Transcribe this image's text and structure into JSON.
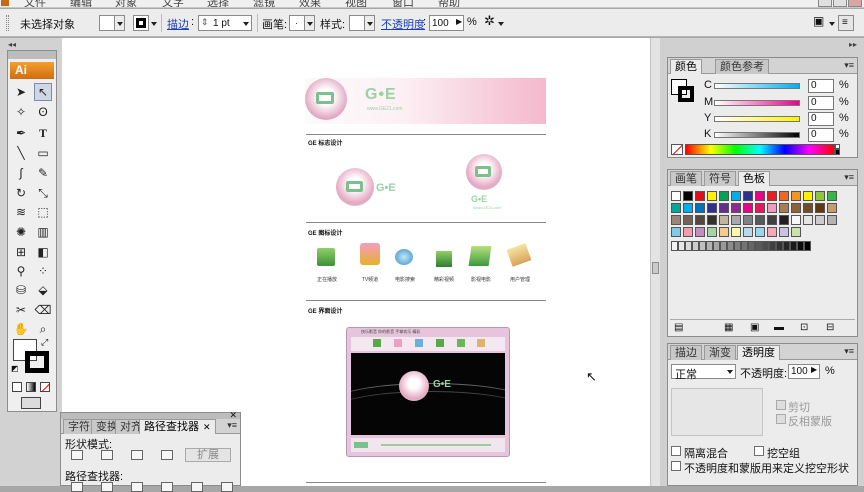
{
  "menubar": {
    "items": [
      "文件",
      "编辑",
      "对象",
      "文字",
      "选择",
      "滤镜",
      "效果",
      "视图",
      "窗口",
      "帮助"
    ]
  },
  "control_bar": {
    "selection_label": "未选择对象",
    "stroke_link": "描边",
    "stroke_weight": "1 pt",
    "brush_label": "画笔:",
    "style_label": "样式:",
    "opacity_link": "不透明度",
    "opacity_value": "100",
    "opacity_unit": "%"
  },
  "toolbox": {
    "logo": "Ai"
  },
  "artboard": {
    "brand": "G•E",
    "url": "www.GE21.com",
    "section_logo": "GE 标志设计",
    "section_icons": "GE 图标设计",
    "section_ui": "GE 界面设计",
    "icons": [
      "正在播放",
      "TV频道",
      "电影搜索",
      "精彩视频",
      "影视电影",
      "用户管理"
    ],
    "player_title": "快乐影音 你的影音 手掌欢乐 精彩",
    "player_brand": "G•E"
  },
  "color_panel": {
    "tabs": [
      "颜色",
      "颜色参考"
    ],
    "channels": [
      {
        "label": "C",
        "value": "0",
        "unit": "%"
      },
      {
        "label": "M",
        "value": "0",
        "unit": "%"
      },
      {
        "label": "Y",
        "value": "0",
        "unit": "%"
      },
      {
        "label": "K",
        "value": "0",
        "unit": "%"
      }
    ]
  },
  "swatch_panel": {
    "tabs": [
      "画笔",
      "符号",
      "色板"
    ],
    "colors": [
      "#ffffff",
      "#000000",
      "#e30d18",
      "#fff100",
      "#00a551",
      "#00adef",
      "#2e3192",
      "#ec008c",
      "#ed1c24",
      "#f26522",
      "#f7941d",
      "#fff200",
      "#8dc63f",
      "#39b54a",
      "#00a99d",
      "#00aeef",
      "#0072bc",
      "#2e3192",
      "#662d91",
      "#92278f",
      "#ec008c",
      "#ed145b",
      "#f49ac1",
      "#a67c52",
      "#8c6239",
      "#754c24",
      "#603913",
      "#c69c6d",
      "#998675",
      "#736357",
      "#534741",
      "#362f2d",
      "#c2b59b",
      "#a7a9ac",
      "#808285",
      "#58595b",
      "#414042",
      "#231f20",
      "#f7f7f7",
      "#e6e6e6",
      "#cccccc",
      "#b3b3b3",
      "#7ecbe5",
      "#f49cad",
      "#c78bbf",
      "#a3d5a3",
      "#f7c98b",
      "#fff9ae",
      "#b4dced",
      "#9ad5f0",
      "#f5a9b8",
      "#cbc1e1",
      "#c8e3a6"
    ],
    "grays": [
      "#f2f2f2",
      "#e6e6e6",
      "#d9d9d9",
      "#cccccc",
      "#bfbfbf",
      "#b3b3b3",
      "#a6a6a6",
      "#999999",
      "#8c8c8c",
      "#808080",
      "#737373",
      "#666666",
      "#595959",
      "#4d4d4d",
      "#404040",
      "#333333",
      "#262626",
      "#1a1a1a",
      "#0d0d0d",
      "#000000"
    ]
  },
  "transparency_panel": {
    "tabs": [
      "描边",
      "渐变",
      "透明度"
    ],
    "blend_mode": "正常",
    "opacity_label": "不透明度:",
    "opacity_value": "100",
    "opacity_unit": "%",
    "clip_label": "剪切",
    "invert_mask_label": "反相蒙版",
    "isolate_label": "隔离混合",
    "knockout_label": "挖空组",
    "define_knockout_label": "不透明度和蒙版用来定义挖空形状"
  },
  "pathfinder_panel": {
    "tabs": [
      "字符",
      "变换",
      "对齐",
      "路径查找器"
    ],
    "shape_modes_label": "形状模式:",
    "expand_label": "扩展",
    "pathfinders_label": "路径查找器:"
  }
}
